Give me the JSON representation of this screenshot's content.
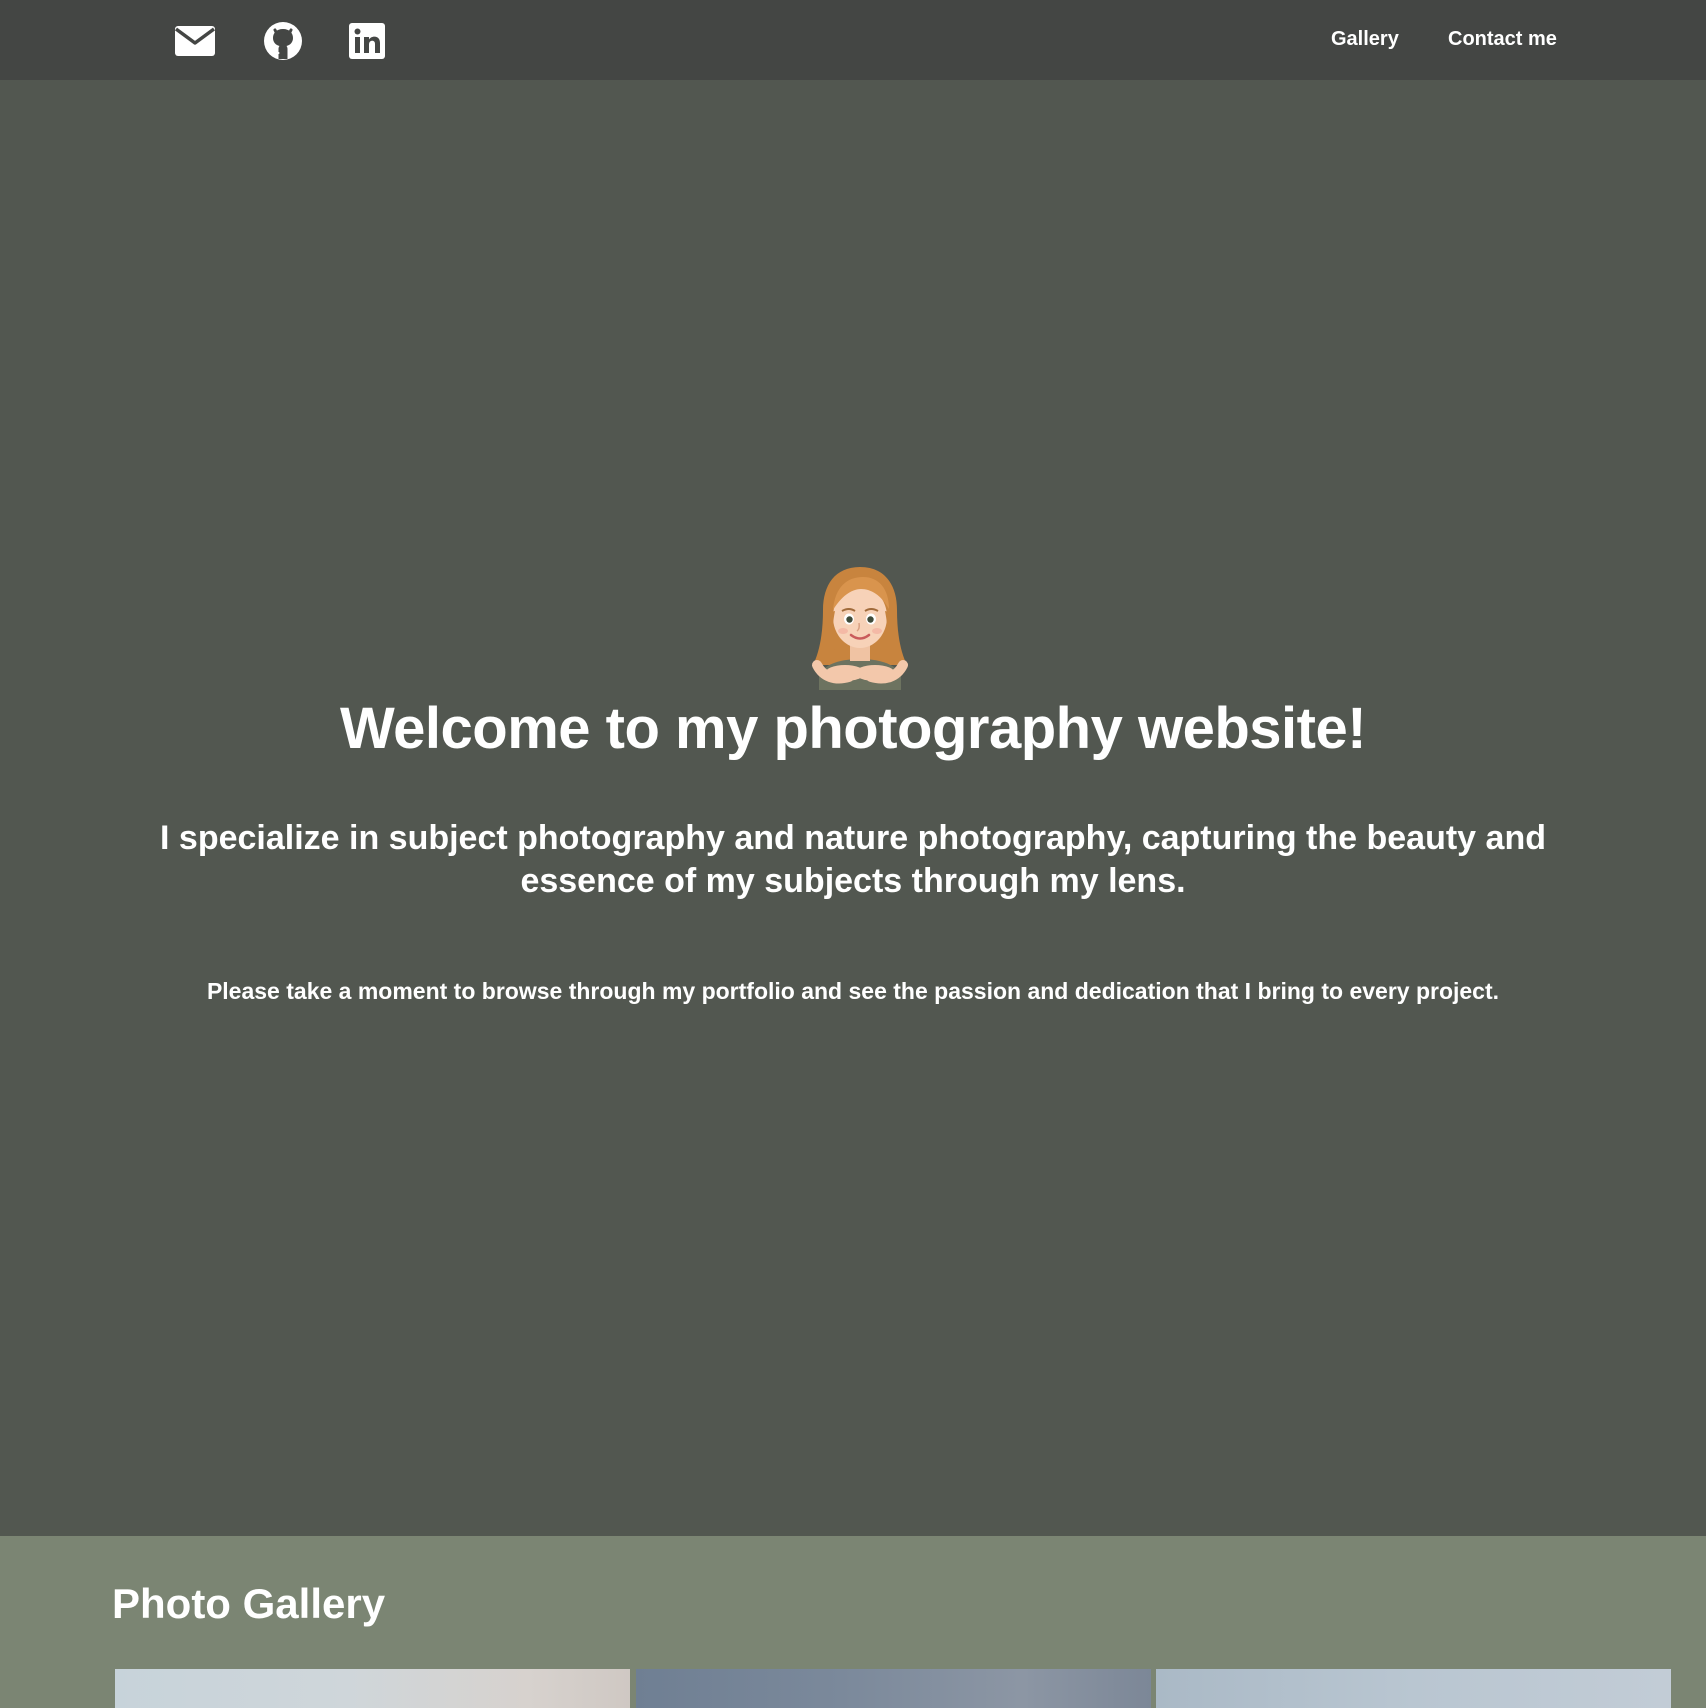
{
  "nav": {
    "social": [
      {
        "icon": "envelope-icon",
        "label": "Email"
      },
      {
        "icon": "github-icon",
        "label": "GitHub"
      },
      {
        "icon": "linkedin-icon",
        "label": "LinkedIn"
      }
    ],
    "links": {
      "gallery": "Gallery",
      "contact": "Contact me"
    }
  },
  "hero": {
    "avatar_icon": "memoji-avatar",
    "title": "Welcome to my photography website!",
    "subtitle": "I specialize in subject photography and nature photography, capturing the beauty and essence of my subjects through my lens.",
    "note": "Please take a moment to browse through my portfolio and see the passion and dedication that I bring to every project."
  },
  "gallery": {
    "title": "Photo Gallery",
    "photos": [
      "photo-1",
      "photo-2",
      "photo-3"
    ]
  },
  "colors": {
    "navbar_bg": "#444644",
    "hero_bg": "#525750",
    "gallery_bg": "#7b8573",
    "text": "#ffffff"
  }
}
